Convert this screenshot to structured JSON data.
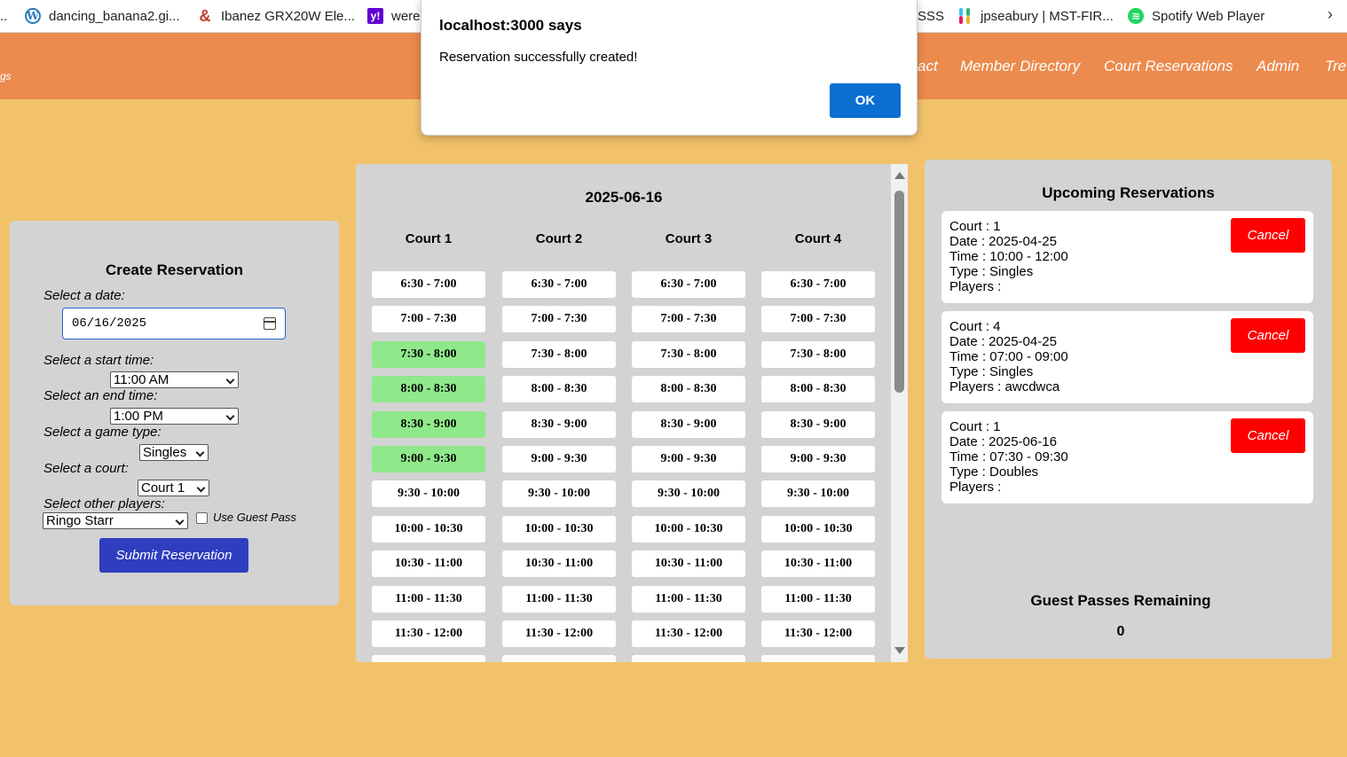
{
  "bookmarks": [
    {
      "label": "dancing_banana2.gi...",
      "icon": "wordpress-icon"
    },
    {
      "label": "Ibanez GRX20W Ele...",
      "icon": "ibanez-icon"
    },
    {
      "label": "were",
      "icon": "yahoo-icon"
    },
    {
      "label": "SSS",
      "icon": ""
    },
    {
      "label": "jpseabury | MST-FIR...",
      "icon": "slack-icon"
    },
    {
      "label": "Spotify Web Player",
      "icon": "spotify-icon"
    }
  ],
  "nav": {
    "left_fragment": "gs",
    "links": [
      "act",
      "Member Directory",
      "Court Reservations",
      "Admin",
      "Tre"
    ]
  },
  "dialog": {
    "title": "localhost:3000 says",
    "message": "Reservation successfully created!",
    "ok_label": "OK"
  },
  "create": {
    "title": "Create Reservation",
    "date_label": "Select a date:",
    "date_value": "06/16/2025",
    "start_label": "Select a start time:",
    "start_value": "11:00 AM",
    "end_label": "Select an end time:",
    "end_value": "1:00 PM",
    "game_label": "Select a game type:",
    "game_value": "Singles",
    "court_label": "Select a court:",
    "court_value": "Court 1",
    "players_label": "Select other players:",
    "players_value": "Ringo Starr",
    "guest_pass_label": "Use Guest Pass",
    "submit_label": "Submit Reservation"
  },
  "schedule": {
    "date": "2025-06-16",
    "courts": [
      "Court 1",
      "Court 2",
      "Court 3",
      "Court 4"
    ],
    "slots": [
      "6:30 - 7:00",
      "7:00 - 7:30",
      "7:30 - 8:00",
      "8:00 - 8:30",
      "8:30 - 9:00",
      "9:00 - 9:30",
      "9:30 - 10:00",
      "10:00 - 10:30",
      "10:30 - 11:00",
      "11:00 - 11:30",
      "11:30 - 12:00"
    ],
    "highlight_color": "#8fe88a",
    "highlighted": {
      "Court 1": [
        "7:30 - 8:00",
        "8:00 - 8:30",
        "8:30 - 9:00",
        "9:00 - 9:30"
      ]
    }
  },
  "upcoming": {
    "title": "Upcoming Reservations",
    "cancel_label": "Cancel",
    "reservations": [
      {
        "court": "Court : 1",
        "date": "Date : 2025-04-25",
        "time": "Time : 10:00 - 12:00",
        "type": "Type : Singles",
        "players": "Players :"
      },
      {
        "court": "Court : 4",
        "date": "Date : 2025-04-25",
        "time": "Time : 07:00 - 09:00",
        "type": "Type : Singles",
        "players": "Players : awcdwca"
      },
      {
        "court": "Court : 1",
        "date": "Date : 2025-06-16",
        "time": "Time : 07:30 - 09:30",
        "type": "Type : Doubles",
        "players": "Players :"
      }
    ],
    "guest_title": "Guest Passes Remaining",
    "guest_count": "0"
  },
  "colors": {
    "page_bg": "#f2c26b",
    "navbar": "#ec8b4e",
    "panel": "#d3d3d3",
    "submit": "#2f3ebf",
    "cancel": "#ff0000",
    "ok": "#0a6fd1"
  }
}
